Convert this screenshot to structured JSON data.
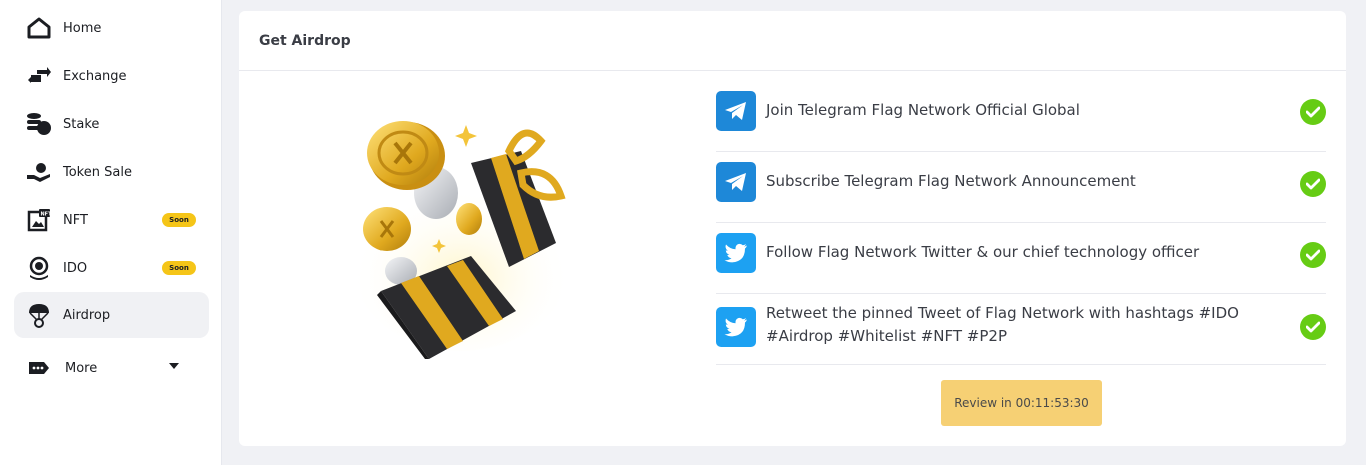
{
  "sidebar": {
    "items": [
      {
        "label": "Home",
        "icon": "home-icon"
      },
      {
        "label": "Exchange",
        "icon": "exchange-icon"
      },
      {
        "label": "Stake",
        "icon": "stake-icon"
      },
      {
        "label": "Token Sale",
        "icon": "token-sale-icon"
      },
      {
        "label": "NFT",
        "icon": "nft-icon",
        "badge": "Soon"
      },
      {
        "label": "IDO",
        "icon": "ido-icon",
        "badge": "Soon"
      },
      {
        "label": "Airdrop",
        "icon": "airdrop-icon",
        "active": true
      },
      {
        "label": "More",
        "icon": "more-icon"
      }
    ]
  },
  "main": {
    "title": "Get Airdrop",
    "tasks": [
      {
        "text": "Join Telegram Flag Network Official Global",
        "icon": "telegram-icon",
        "done": true
      },
      {
        "text": "Subscribe Telegram Flag Network Announcement",
        "icon": "telegram-icon",
        "done": true
      },
      {
        "text": "Follow Flag Network Twitter & our chief technology officer",
        "icon": "twitter-icon",
        "done": true
      },
      {
        "text": "Retweet the pinned Tweet of Flag Network with hashtags #IDO #Airdrop #Whitelist #NFT #P2P",
        "icon": "twitter-icon",
        "done": true
      }
    ],
    "review_button": "Review in 00:11:53:30"
  },
  "colors": {
    "telegram": "#1e88d8",
    "twitter": "#1da1f2",
    "check": "#66cc14",
    "review_button": "#f6d074",
    "soon_badge": "#f5c518",
    "gold": "#e0a91f"
  }
}
